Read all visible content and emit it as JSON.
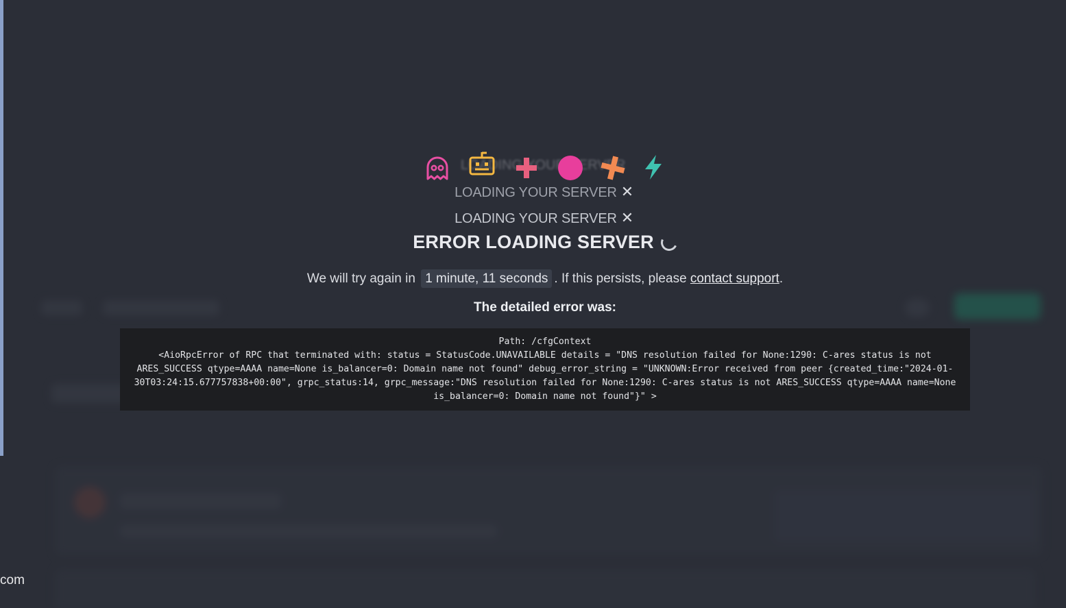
{
  "loading": {
    "ghost_text": "LOADING YOUR SERVER",
    "line1": "LOADING YOUR SERVER",
    "line2": "LOADING YOUR SERVER",
    "close_glyph": "✕"
  },
  "icons": {
    "ghost": "ghost-icon",
    "robot": "robot-icon",
    "plus": "plus-icon",
    "circle": "circle-icon",
    "cross": "cross-icon",
    "lightning": "lightning-icon",
    "colors": {
      "ghost": "#e84fa3",
      "robot": "#f5b841",
      "plus": "#e8607f",
      "circle": "#e83e9c",
      "cross": "#f28a52",
      "lightning": "#3fc2b0"
    }
  },
  "error": {
    "title": "ERROR LOADING SERVER",
    "retry_prefix": "We will try again in",
    "retry_time": "1 minute, 11 seconds",
    "retry_suffix": ". If this persists, please",
    "support_link": "contact support",
    "retry_end": ".",
    "detail_heading": "The detailed error was:",
    "detail_text": "Path: /cfgContext\n<AioRpcError of RPC that terminated with: status = StatusCode.UNAVAILABLE details = \"DNS resolution failed for None:1290: C-ares status is not ARES_SUCCESS qtype=AAAA name=None is_balancer=0: Domain name not found\" debug_error_string = \"UNKNOWN:Error received from peer {created_time:\"2024-01-30T03:24:15.677757838+00:00\", grpc_status:14, grpc_message:\"DNS resolution failed for None:1290: C-ares status is not ARES_SUCCESS qtype=AAAA name=None is_balancer=0: Domain name not found\"}\" >"
  },
  "background": {
    "domain_fragment": "com"
  }
}
